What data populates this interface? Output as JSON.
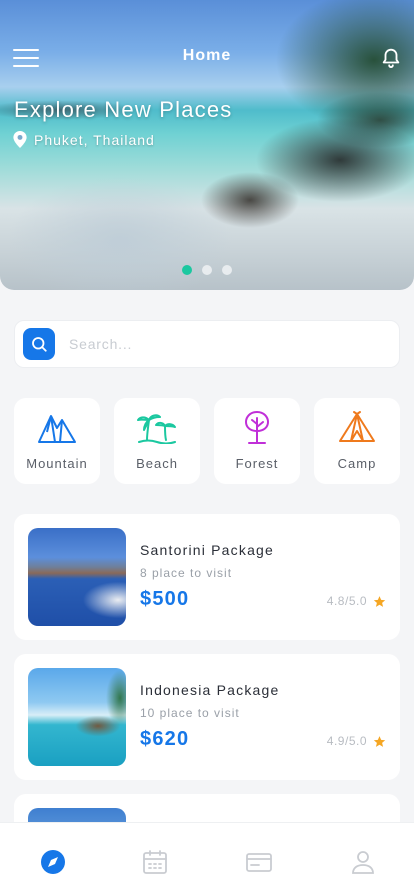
{
  "header": {
    "title": "Home",
    "hero_title": "Explore New Places",
    "location": "Phuket, Thailand",
    "carousel_total": 3,
    "carousel_active": 1
  },
  "search": {
    "placeholder": "Search..."
  },
  "categories": [
    {
      "label": "Mountain",
      "icon": "mountain-icon",
      "color": "#1677e8"
    },
    {
      "label": "Beach",
      "icon": "palm-tree-icon",
      "color": "#1bc8a0"
    },
    {
      "label": "Forest",
      "icon": "tree-icon",
      "color": "#c02fd8"
    },
    {
      "label": "Camp",
      "icon": "tent-icon",
      "color": "#ef7a1d"
    }
  ],
  "packages": [
    {
      "name": "Santorini Package",
      "places": "8 place to visit",
      "price": "$500",
      "rating": "4.8/5.0"
    },
    {
      "name": "Indonesia Package",
      "places": "10 place to visit",
      "price": "$620",
      "rating": "4.9/5.0"
    }
  ],
  "nav": {
    "items": [
      "explore-icon",
      "calendar-icon",
      "card-icon",
      "profile-icon"
    ],
    "active": "explore-icon",
    "active_color": "#1677e8",
    "inactive_color": "#c9ccd1"
  },
  "colors": {
    "accent": "#1677e8",
    "carousel_active": "#1bc8a0",
    "star": "#f5a623"
  }
}
